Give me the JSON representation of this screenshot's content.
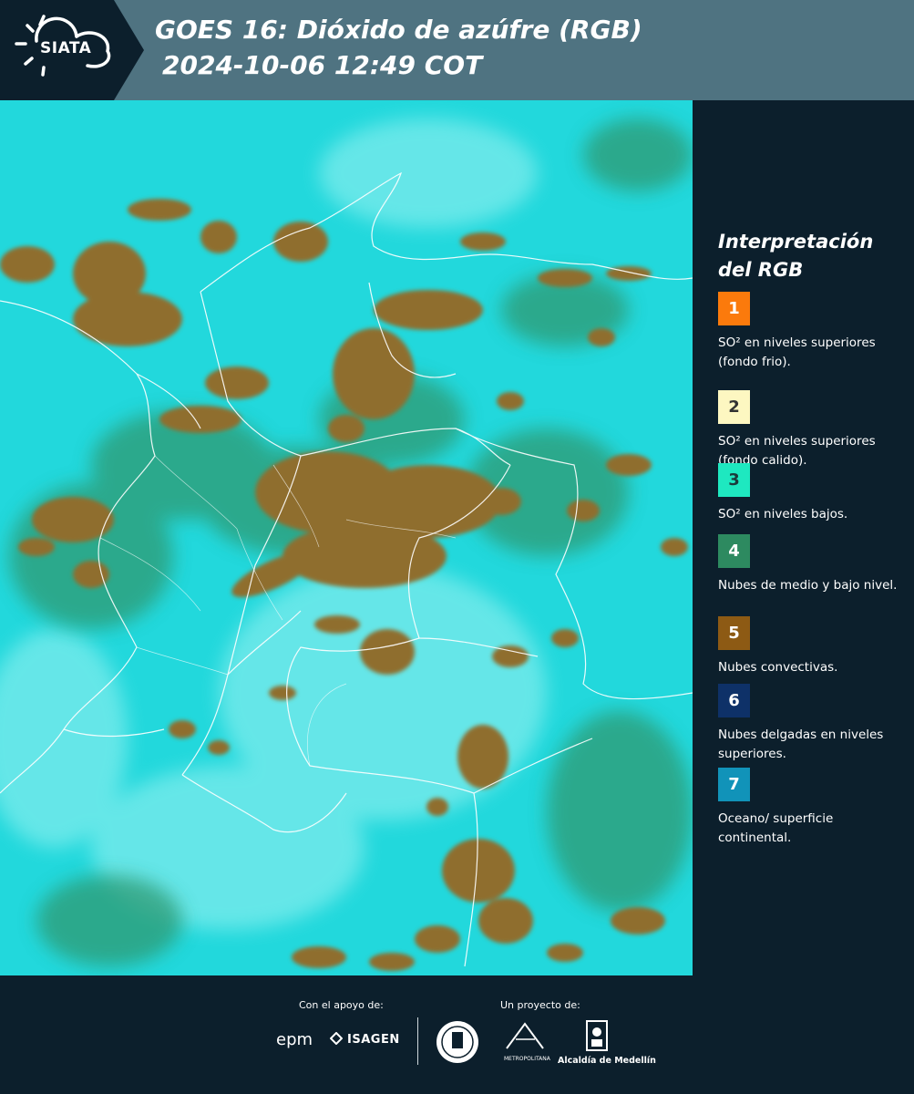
{
  "header": {
    "logo_text": "SIATA",
    "title_line1": "GOES 16: Dióxido de azúfre (RGB)",
    "title_line2": "2024-10-06 12:49 COT"
  },
  "legend": {
    "title_line1": "Interpretación",
    "title_line2": "del RGB",
    "items": [
      {
        "number": "1",
        "color": "#fb7a0c",
        "text_color": "#ffffff",
        "label": "SO² en niveles superiores (fondo frio)."
      },
      {
        "number": "2",
        "color": "#fdf7c1",
        "text_color": "#333333",
        "label": "SO² en niveles superiores (fondo calido)."
      },
      {
        "number": "3",
        "color": "#1ee8c0",
        "text_color": "#1b3b3b",
        "label": "SO² en niveles bajos."
      },
      {
        "number": "4",
        "color": "#2d8a60",
        "text_color": "#ffffff",
        "label": "Nubes de medio y bajo nivel."
      },
      {
        "number": "5",
        "color": "#8d5a14",
        "text_color": "#ffffff",
        "label": "Nubes convectivas."
      },
      {
        "number": "6",
        "color": "#0e3168",
        "text_color": "#ffffff",
        "label": "Nubes delgadas en niveles superiores."
      },
      {
        "number": "7",
        "color": "#1193b9",
        "text_color": "#ffffff",
        "label": "Oceano/ superficie continental."
      }
    ]
  },
  "footer": {
    "support_label": "Con el apoyo de:",
    "project_label": "Un proyecto de:",
    "epm": "epm",
    "isagen": "ISAGEN",
    "area_text": "METROPOLITANA",
    "alcaldia": "Alcaldía de Medellín"
  },
  "colors": {
    "header_bg": "#4f7381",
    "panel_bg": "#0c1f2c",
    "ocean_cyan": "#22d8dc",
    "convective_brown": "#8d6b2c"
  }
}
